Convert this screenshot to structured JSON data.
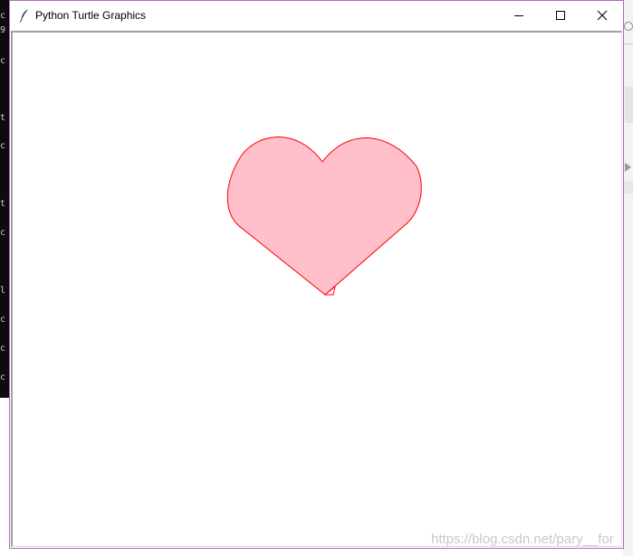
{
  "window": {
    "title": "Python Turtle Graphics",
    "icon": "feather-icon",
    "controls": {
      "minimize": "minimize-icon",
      "maximize": "maximize-icon",
      "close": "close-icon"
    }
  },
  "canvas": {
    "background": "#ffffff",
    "shape": "heart",
    "fill_color": "#ffc0cb",
    "pen_color": "#ff0000",
    "cursor": "turtle-arrow-icon"
  },
  "background_terminal_glyphs": [
    "c",
    "9",
    "c",
    "t",
    "c",
    "t",
    "c",
    "l",
    "c",
    "c",
    "c"
  ],
  "watermark": "https://blog.csdn.net/pary__for"
}
